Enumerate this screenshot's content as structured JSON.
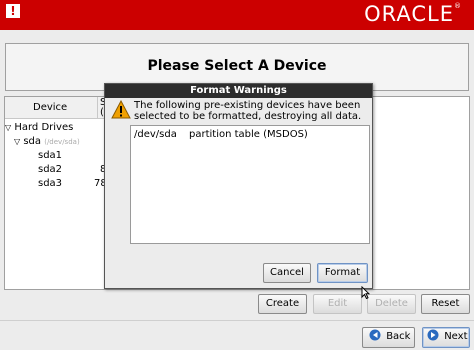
{
  "brand": {
    "logo_text": "ORACLE",
    "reg_mark": "®",
    "app_icon": "!"
  },
  "header": {
    "title": "Please Select A Device"
  },
  "tree": {
    "columns": {
      "device": "Device",
      "size_partial": "S",
      "size_partial2": "("
    },
    "rows": [
      {
        "label": "Hard Drives",
        "expander": "▽"
      },
      {
        "label": "sda",
        "sub": "(/dev/sda)",
        "expander": "▽"
      },
      {
        "label": "sda1",
        "size": ""
      },
      {
        "label": "sda2",
        "size": "8"
      },
      {
        "label": "sda3",
        "size": "78"
      }
    ]
  },
  "actions": {
    "create": "Create",
    "edit": "Edit",
    "delete": "Delete",
    "reset": "Reset"
  },
  "nav": {
    "back": "Back",
    "next": "Next"
  },
  "dialog": {
    "title": "Format Warnings",
    "message": "The following pre-existing devices have been selected to be formatted, destroying all data.",
    "items": [
      {
        "device": "/dev/sda",
        "description": "partition table (MSDOS)"
      }
    ],
    "cancel": "Cancel",
    "format": "Format"
  },
  "colors": {
    "brand_red": "#cc0000",
    "dialog_title_bg": "#2d2d2d",
    "warning": "#f0a000"
  }
}
